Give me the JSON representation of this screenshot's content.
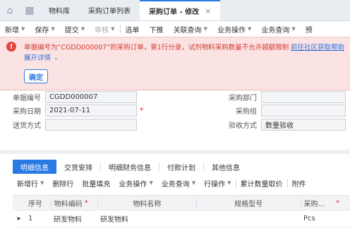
{
  "tabs": {
    "home_icon": "home-icon",
    "apps_icon": "apps-grid-icon",
    "items": [
      {
        "label": "物料库"
      },
      {
        "label": "采购订单列表"
      },
      {
        "label": "采购订单 - 修改",
        "active": true
      }
    ],
    "close_glyph": "×"
  },
  "toolbar": {
    "items": [
      {
        "label": "新增",
        "dropdown": true
      },
      {
        "label": "保存",
        "dropdown": true
      },
      {
        "label": "提交",
        "dropdown": true
      },
      {
        "label": "审核",
        "dropdown": true,
        "disabled": true
      },
      {
        "label": "选单"
      },
      {
        "label": "下推"
      },
      {
        "label": "关联查询",
        "dropdown": true
      },
      {
        "label": "业务操作",
        "dropdown": true
      },
      {
        "label": "业务查询",
        "dropdown": true
      },
      {
        "label": "预"
      }
    ]
  },
  "error": {
    "icon": "error-icon",
    "message": "单据编号为“CGDD000007”的采购订单，第1行分录，试剂物料采购数量不允许超额限制",
    "link": "前往社区获取帮助",
    "expand_label": "展开详情",
    "confirm_label": "确定",
    "colors": {
      "background": "#fbe3e3",
      "text": "#d23b33",
      "accent": "#2a7ae4"
    }
  },
  "form": {
    "bill_no": {
      "label": "单据编号",
      "value": "CGDD000007"
    },
    "purchase_date": {
      "label": "采购日期",
      "value": "2021-07-11",
      "required": "*"
    },
    "ship_method": {
      "label": "送货方式",
      "value": ""
    },
    "purchase_dept": {
      "label": "采购部门",
      "value": ""
    },
    "purchase_group": {
      "label": "采购组",
      "value": ""
    },
    "inspection_method": {
      "label": "验收方式",
      "value": "数量验收"
    }
  },
  "detail": {
    "tabs": [
      "明细信息",
      "交货安排",
      "明细财务信息",
      "付款计划",
      "其他信息"
    ],
    "toolbar": [
      {
        "label": "新增行",
        "dropdown": true
      },
      {
        "label": "删除行"
      },
      {
        "label": "批量填充"
      },
      {
        "label": "业务操作",
        "dropdown": true
      },
      {
        "label": "业务查询",
        "dropdown": true
      },
      {
        "label": "行操作",
        "dropdown": true
      },
      {
        "label": "累计数量取价"
      },
      {
        "label": "附件"
      }
    ],
    "columns": {
      "seq": "序号",
      "material_code": "物料编码",
      "material_name": "物料名称",
      "spec": "规格型号",
      "purchase_unit": "采购...",
      "required_mark": "*"
    },
    "rows": [
      {
        "seq": "1",
        "material_code": "研发物料",
        "material_name": "研发物料",
        "spec": "",
        "purchase_unit": "Pcs"
      }
    ]
  }
}
